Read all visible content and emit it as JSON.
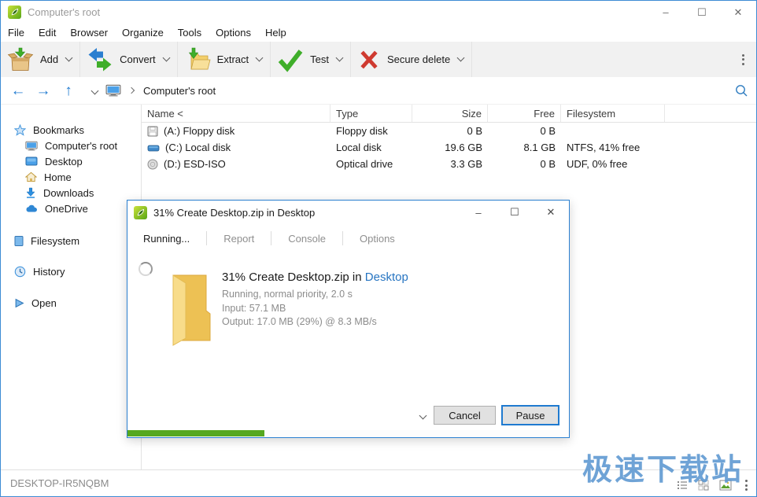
{
  "window": {
    "title": "Computer's root",
    "controls": {
      "minimize": "–",
      "maximize": "☐",
      "close": "✕"
    }
  },
  "menu": {
    "items": [
      "File",
      "Edit",
      "Browser",
      "Organize",
      "Tools",
      "Options",
      "Help"
    ]
  },
  "toolbar": {
    "buttons": [
      {
        "label": "Add",
        "icon": "archive-add-icon"
      },
      {
        "label": "Convert",
        "icon": "convert-icon"
      },
      {
        "label": "Extract",
        "icon": "extract-icon"
      },
      {
        "label": "Test",
        "icon": "test-checkmark-icon"
      },
      {
        "label": "Secure delete",
        "icon": "secure-delete-icon"
      }
    ]
  },
  "navbar": {
    "breadcrumb": "Computer's root"
  },
  "sidebar": {
    "bookmarks": {
      "label": "Bookmarks",
      "items": [
        {
          "label": "Computer's root",
          "icon": "computer-icon"
        },
        {
          "label": "Desktop",
          "icon": "desktop-icon"
        },
        {
          "label": "Home",
          "icon": "home-icon"
        },
        {
          "label": "Downloads",
          "icon": "download-icon"
        },
        {
          "label": "OneDrive",
          "icon": "cloud-icon"
        }
      ]
    },
    "filesystem_label": "Filesystem",
    "history_label": "History",
    "open_label": "Open"
  },
  "file_list": {
    "columns": [
      "Name <",
      "Type",
      "Size",
      "Free",
      "Filesystem"
    ],
    "rows": [
      {
        "name": "(A:) Floppy disk",
        "type": "Floppy disk",
        "size": "0 B",
        "free": "0 B",
        "filesystem": "",
        "icon": "floppy-icon"
      },
      {
        "name": "(C:) Local disk",
        "type": "Local disk",
        "size": "19.6 GB",
        "free": "8.1 GB",
        "filesystem": "NTFS, 41% free",
        "icon": "hard-disk-icon"
      },
      {
        "name": "(D:) ESD-ISO",
        "type": "Optical drive",
        "size": "3.3 GB",
        "free": "0 B",
        "filesystem": "UDF, 0% free",
        "icon": "optical-disc-icon"
      }
    ]
  },
  "dialog": {
    "title": "31% Create Desktop.zip in Desktop",
    "controls": {
      "minimize": "–",
      "maximize": "☐",
      "close": "✕"
    },
    "tabs": [
      {
        "label": "Running...",
        "active": true
      },
      {
        "label": "Report",
        "active": false
      },
      {
        "label": "Console",
        "active": false
      },
      {
        "label": "Options",
        "active": false
      }
    ],
    "task": {
      "headline_prefix": "31% Create Desktop.zip in ",
      "headline_link": "Desktop",
      "status_line": "Running, normal priority, 2.0 s",
      "input_line": "Input: 57.1 MB",
      "output_line": "Output: 17.0 MB (29%) @ 8.3 MB/s"
    },
    "buttons": {
      "cancel": "Cancel",
      "pause": "Pause"
    },
    "progress_percent": 31,
    "progress_color": "#55a820",
    "accent_color": "#1f7ad0"
  },
  "statusbar": {
    "machine_name": "DESKTOP-IR5NQBM"
  },
  "watermark": {
    "text": "极速下载站",
    "color": "#5794cf"
  }
}
